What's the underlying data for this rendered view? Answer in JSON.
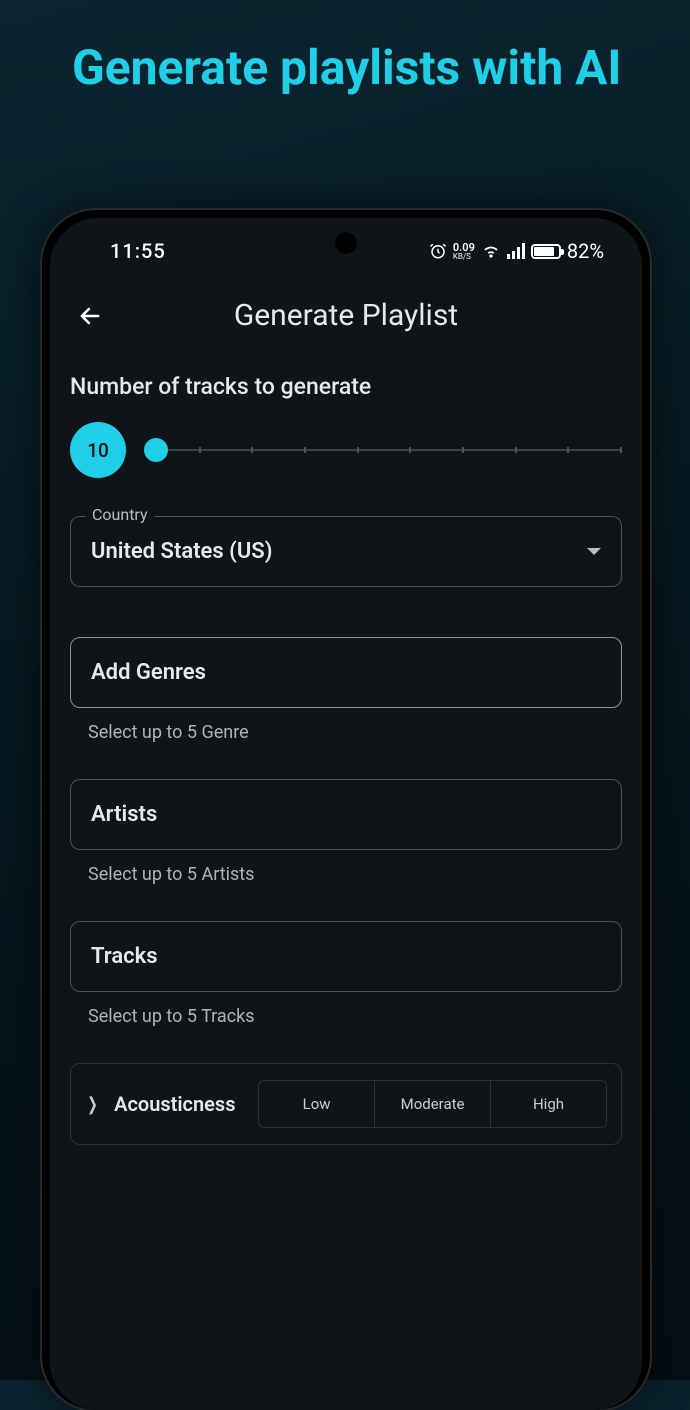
{
  "headline": "Generate playlists with AI",
  "status": {
    "time": "11:55",
    "kbs_value": "0.09",
    "kbs_unit": "KB/S",
    "battery_text": "82%",
    "battery_pct": 82
  },
  "app": {
    "title": "Generate Playlist"
  },
  "tracks_count": {
    "label": "Number of tracks to generate",
    "value": "10",
    "slider_pct": 2
  },
  "country": {
    "legend": "Country",
    "value": "United States (US)"
  },
  "genres": {
    "placeholder": "Add Genres",
    "helper": "Select up to 5 Genre"
  },
  "artists": {
    "placeholder": "Artists",
    "helper": "Select up to 5 Artists"
  },
  "tracks": {
    "placeholder": "Tracks",
    "helper": "Select up to 5 Tracks"
  },
  "attr": {
    "label": "Acousticness",
    "options": {
      "low": "Low",
      "moderate": "Moderate",
      "high": "High"
    }
  }
}
